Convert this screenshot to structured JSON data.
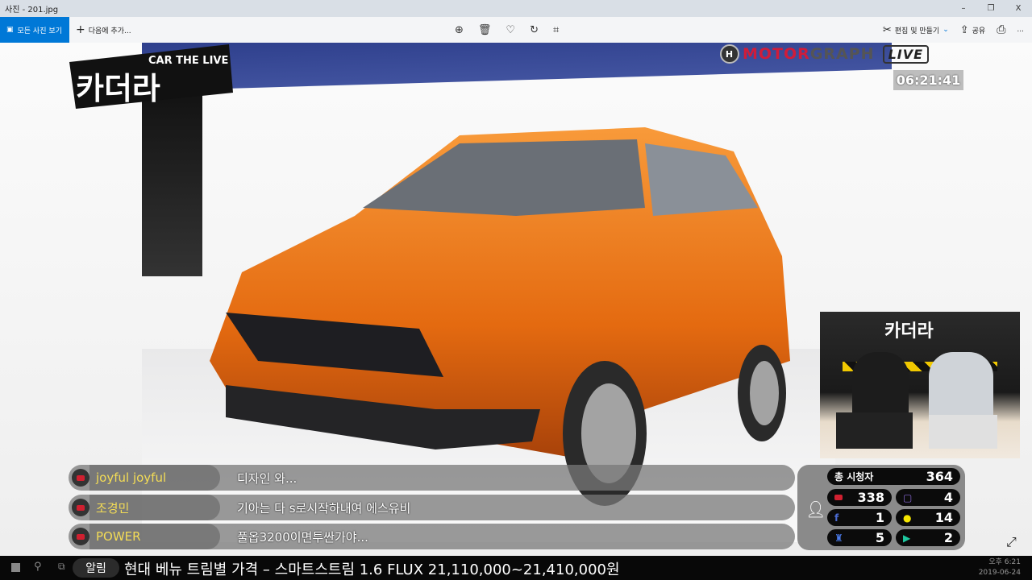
{
  "window": {
    "title": "사진 - 201.jpg",
    "minimize": "–",
    "restore": "❐",
    "close": "X"
  },
  "toolbar": {
    "all_photos": "모든 사진 보기",
    "add_to": "다음에 추가...",
    "edit_create": "편집 및 만들기",
    "share": "공유",
    "more": "..."
  },
  "overlay": {
    "logo_text": "카더라",
    "logo_sub": "CAR THE LIVE",
    "brand_red": "MOTOR",
    "brand_gray": "GRAPH",
    "live": "LIVE",
    "clock": "06:21:41",
    "cam_title": "카더라"
  },
  "chat": [
    {
      "user": "joyful joyful",
      "message": "디자인 와..."
    },
    {
      "user": "조경민",
      "message": "기아는 다 s로시작하내여 에스유비"
    },
    {
      "user": "POWER",
      "message": "풀옵3200이면투싼가야..."
    }
  ],
  "stats": {
    "total_label": "총 시청자",
    "total": "364",
    "youtube": "338",
    "twitch": "4",
    "facebook": "1",
    "kakao": "14",
    "afreeca": "5",
    "naver": "2"
  },
  "taskbar": {
    "alert": "알림",
    "ticker": "현대 베뉴 트림별 가격 – 스마트스트림 1.6 FLUX 21,110,000~21,410,000원",
    "time": "오후 6:21",
    "date": "2019-06-24"
  },
  "colors": {
    "accent": "#0078d7",
    "youtube": "#d02030",
    "twitch": "#6441a5",
    "kakao": "#f5e600",
    "naver": "#1ec800"
  }
}
